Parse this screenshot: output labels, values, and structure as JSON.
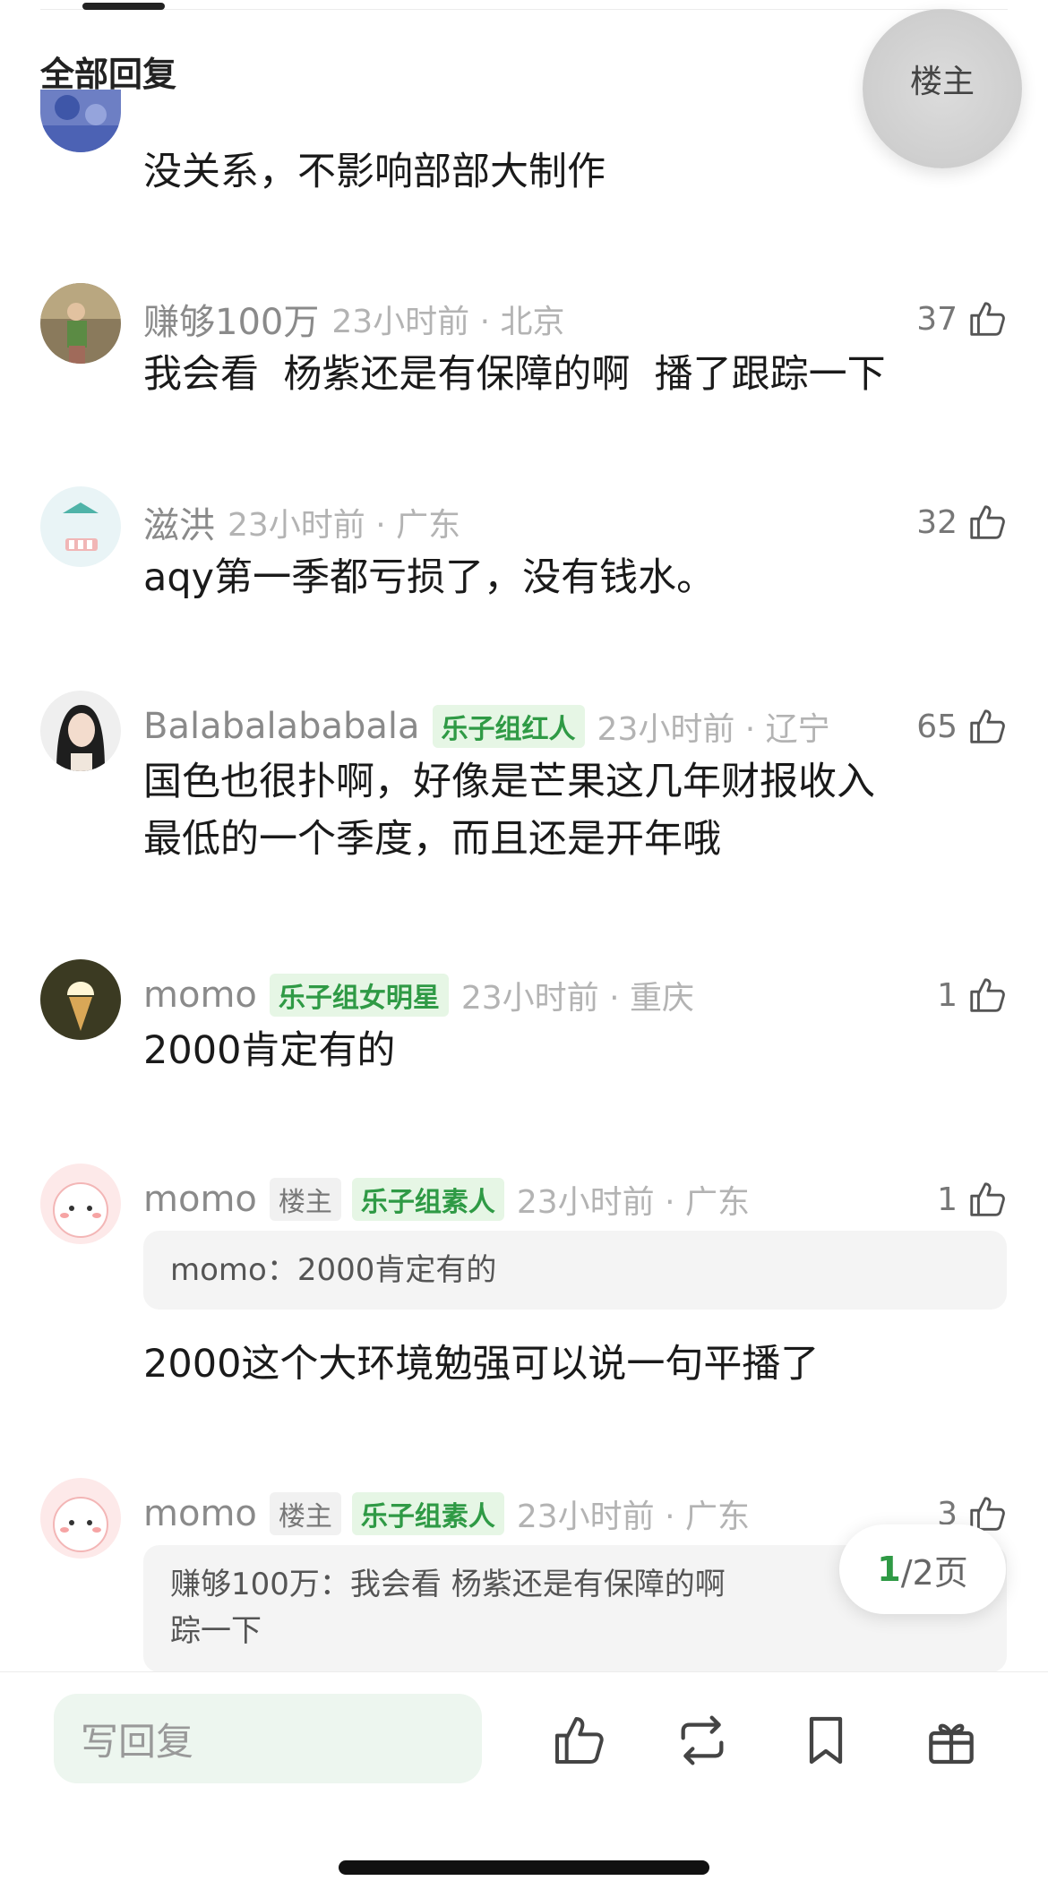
{
  "header": {
    "title": "全部回复",
    "op_label": "楼主"
  },
  "comments": [
    {
      "body": "没关系，不影响部部大制作"
    },
    {
      "username": "赚够100万",
      "time_loc": "23小时前 · 北京",
      "likes": "37",
      "body": "我会看  杨紫还是有保障的啊  播了跟踪一下"
    },
    {
      "username": "滋洪",
      "time_loc": "23小时前 · 广东",
      "likes": "32",
      "body": "aqy第一季都亏损了，没有钱水。"
    },
    {
      "username": "Balabalababala",
      "badge": "乐子组红人",
      "time_loc": "23小时前 · 辽宁",
      "likes": "65",
      "body_line1": "国色也很扑啊，好像是芒果这几年财报收入",
      "body_line2": "最低的一个季度，而且还是开年哦"
    },
    {
      "username": "momo",
      "badge": "乐子组女明星",
      "time_loc": "23小时前 · 重庆",
      "likes": "1",
      "body": "2000肯定有的"
    },
    {
      "username": "momo",
      "op_badge": "楼主",
      "badge": "乐子组素人",
      "time_loc": "23小时前 · 广东",
      "likes": "1",
      "quote": "momo：2000肯定有的",
      "body": "2000这个大环境勉强可以说一句平播了"
    },
    {
      "username": "momo",
      "op_badge": "楼主",
      "badge": "乐子组素人",
      "time_loc": "23小时前 · 广东",
      "likes": "3",
      "quote_line1": "赚够100万：我会看  杨紫还是有保障的啊",
      "quote_line2": "踪一下"
    }
  ],
  "pager": {
    "current": "1",
    "total_text": "/2页"
  },
  "bottom_bar": {
    "reply_placeholder": "写回复",
    "icons": [
      "like-icon",
      "repost-icon",
      "bookmark-icon",
      "gift-icon"
    ]
  },
  "colors": {
    "accent_green": "#2f9a45",
    "badge_green_bg": "#e6f6e5"
  }
}
